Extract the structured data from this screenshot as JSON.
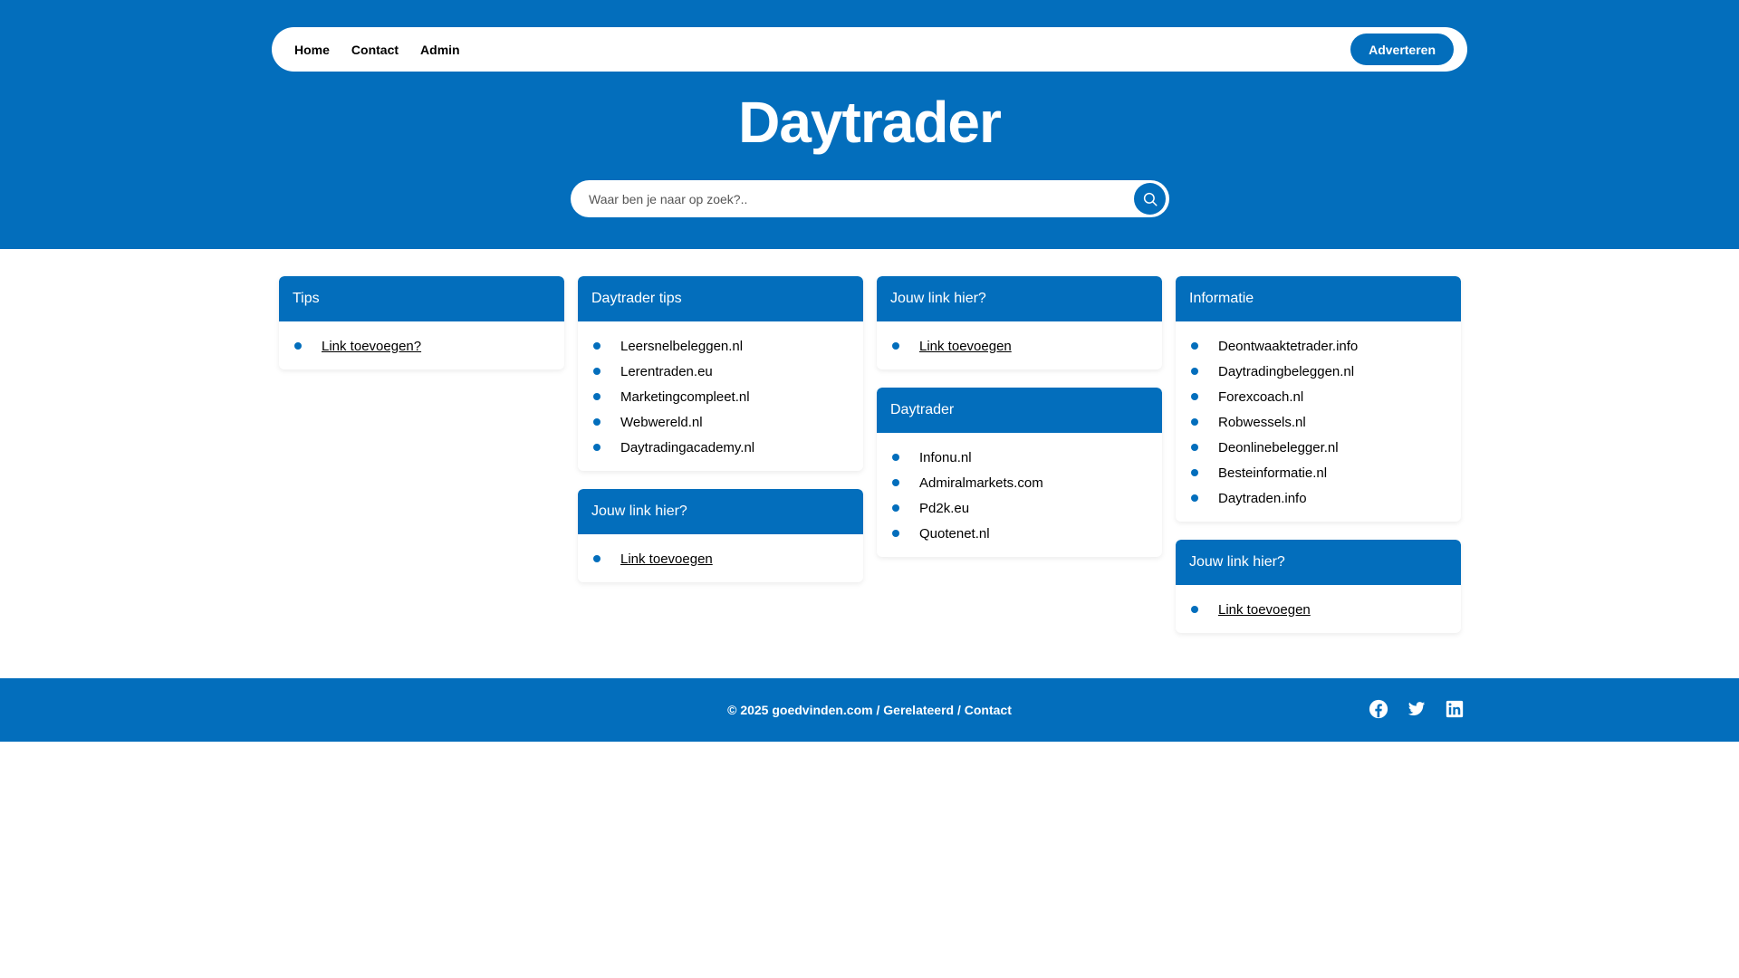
{
  "nav": {
    "links": [
      "Home",
      "Contact",
      "Admin"
    ],
    "advertise_label": "Adverteren"
  },
  "site_title": "Daytrader",
  "search": {
    "placeholder": "Waar ben je naar op zoek?..",
    "value": ""
  },
  "cards": {
    "tips": {
      "title": "Tips",
      "items": [
        "Link toevoegen?"
      ]
    },
    "daytrader_tips": {
      "title": "Daytrader tips",
      "items": [
        "Leersnelbeleggen.nl",
        "Lerentraden.eu",
        "Marketingcompleet.nl",
        "Webwereld.nl",
        "Daytradingacademy.nl"
      ]
    },
    "your_link_2": {
      "title": "Jouw link hier?",
      "items": [
        "Link toevoegen"
      ]
    },
    "your_link_3": {
      "title": "Jouw link hier?",
      "items": [
        "Link toevoegen"
      ]
    },
    "daytrader": {
      "title": "Daytrader",
      "items": [
        "Infonu.nl",
        "Admiralmarkets.com",
        "Pd2k.eu",
        "Quotenet.nl"
      ]
    },
    "informatie": {
      "title": "Informatie",
      "items": [
        "Deontwaaktetrader.info",
        "Daytradingbeleggen.nl",
        "Forexcoach.nl",
        "Robwessels.nl",
        "Deonlinebelegger.nl",
        "Besteinformatie.nl",
        "Daytraden.info"
      ]
    },
    "your_link_4": {
      "title": "Jouw link hier?",
      "items": [
        "Link toevoegen"
      ]
    }
  },
  "footer": {
    "copyright": "© 2025 goedvinden.com",
    "sep1": " / ",
    "related": "Gerelateerd",
    "sep2": " / ",
    "contact": "Contact"
  },
  "icons": {
    "search": "search-icon",
    "socials": [
      "facebook-icon",
      "twitter-icon",
      "linkedin-icon"
    ]
  },
  "colors": {
    "primary": "#036ebc",
    "background": "#ffffff",
    "text": "#000000"
  }
}
